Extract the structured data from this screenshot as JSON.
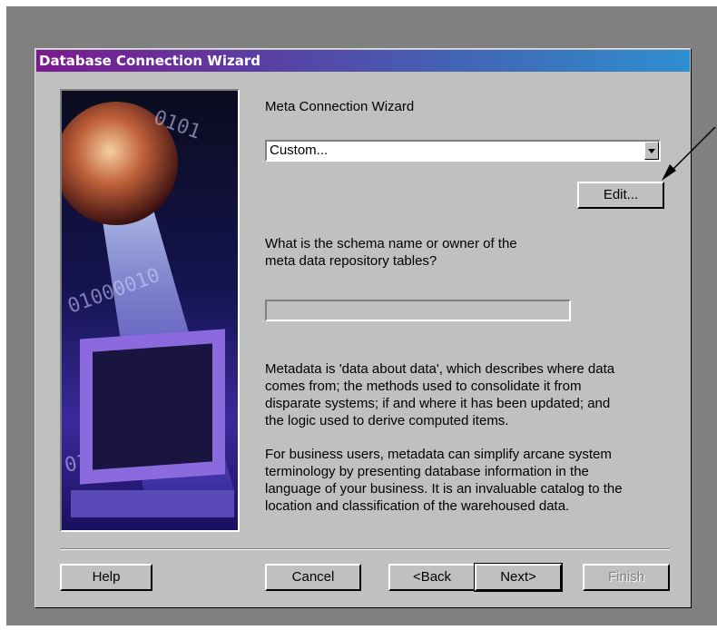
{
  "window": {
    "title": "Database Connection Wizard"
  },
  "main": {
    "heading": "Meta Connection Wizard",
    "select": {
      "value": "Custom..."
    },
    "edit_button": "Edit...",
    "schema_question_line1": "What is the schema name or owner of the",
    "schema_question_line2": "meta data repository tables?",
    "schema_input_value": "",
    "description_lines": [
      "Metadata is 'data about data', which describes where data",
      "comes from; the methods used to consolidate it from",
      "disparate systems;  if and where it has been updated; and",
      "the logic used to derive computed items."
    ],
    "business_lines": [
      "For business users, metadata can simplify arcane system",
      "terminology by presenting database information in the",
      "language of your business. It is an invaluable catalog to the",
      "location and classification of the warehoused data."
    ]
  },
  "footer": {
    "help": "Help",
    "cancel": "Cancel",
    "back": "<Back",
    "next": "Next>",
    "finish": "Finish"
  },
  "icons": {
    "dropdown": "chevron-down-icon",
    "callout": "arrow-icon"
  },
  "colors": {
    "titlebar_start": "#7b1a8e",
    "titlebar_end": "#2e8fd0",
    "dialog_bg": "#c0c0c0"
  }
}
